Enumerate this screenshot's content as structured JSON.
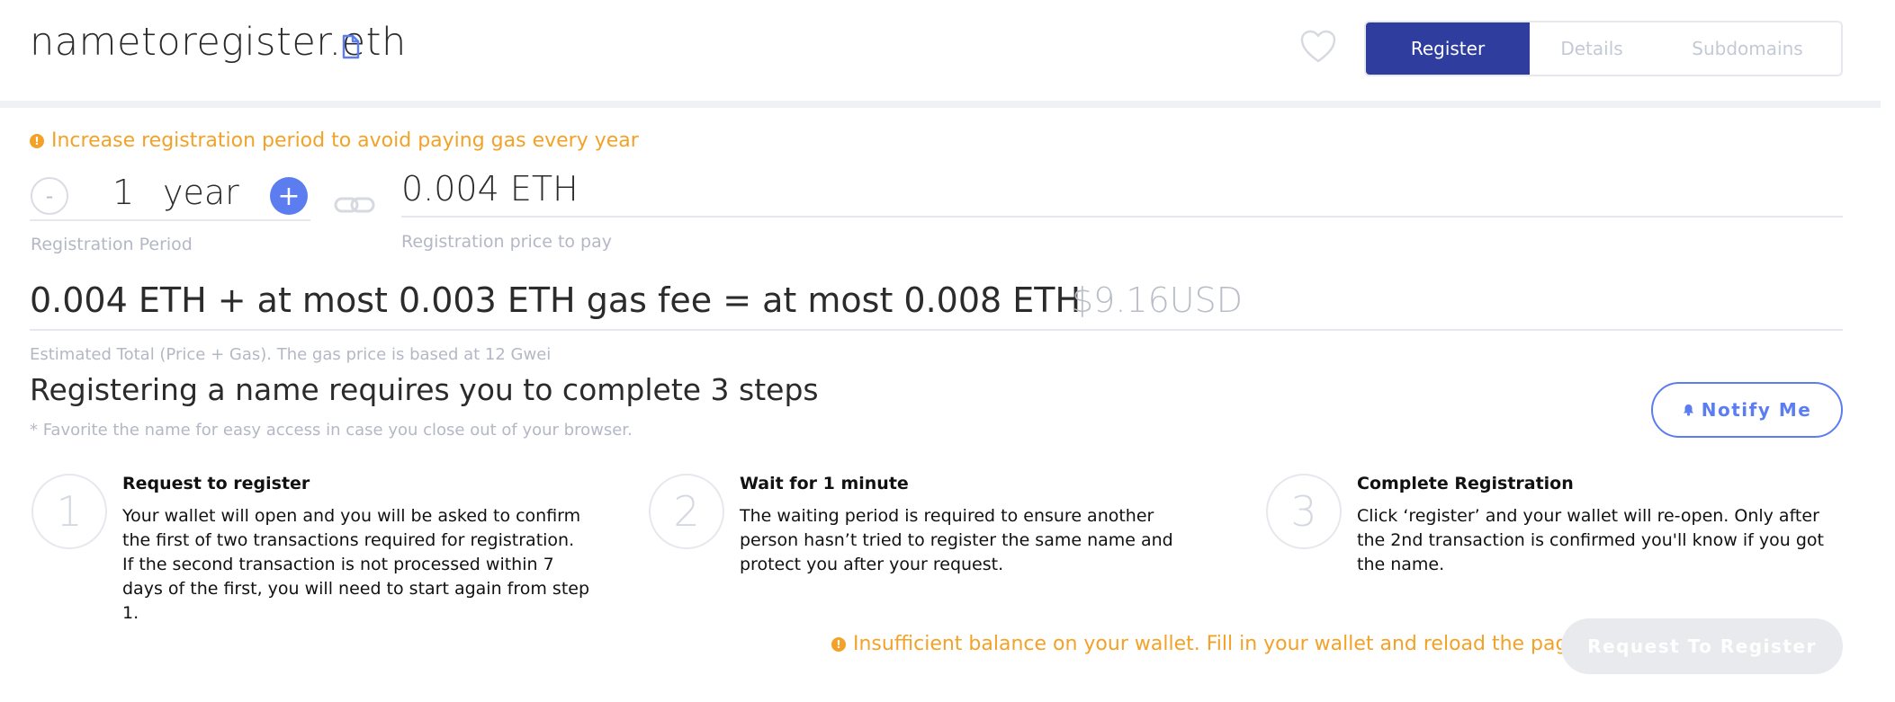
{
  "header": {
    "domain_name": "nametoregister.eth",
    "tabs": [
      {
        "label": "Register",
        "active": true
      },
      {
        "label": "Details",
        "active": false
      },
      {
        "label": "Subdomains",
        "active": false
      }
    ]
  },
  "period_warning": "Increase registration period to avoid paying gas every year",
  "registration": {
    "period_value": "1",
    "period_unit": "year",
    "minus_label": "-",
    "plus_label": "+",
    "period_label": "Registration Period",
    "price": "0.004 ETH",
    "price_label": "Registration price to pay"
  },
  "total": {
    "text": "0.004 ETH + at most 0.003 ETH gas fee = at most 0.008 ETH",
    "usd": "$9.16USD",
    "caption": "Estimated Total (Price + Gas). The gas price is based at 12 Gwei"
  },
  "steps_section": {
    "heading": "Registering a name requires you to complete 3 steps",
    "note": "* Favorite the name for easy access in case you close out of your browser.",
    "notify_label": "Notify Me",
    "steps": [
      {
        "number": "1",
        "title": "Request to register",
        "description": "Your wallet will open and you will be asked to confirm the first of two transactions required for registration. If the second transaction is not processed within 7 days of the first, you will need to start again from step 1."
      },
      {
        "number": "2",
        "title": "Wait for 1 minute",
        "description": "The waiting period is required to ensure another person hasn’t tried to register the same name and protect you after your request."
      },
      {
        "number": "3",
        "title": "Complete Registration",
        "description": "Click ‘register’ and your wallet will re-open. Only after the 2nd transaction is confirmed you'll know if you got the name."
      }
    ]
  },
  "footer": {
    "balance_warning": "Insufficient balance on your wallet. Fill in your wallet and reload the page.",
    "request_label": "Request To Register"
  },
  "colors": {
    "primary": "#2f3e9e",
    "accent": "#5c7df0",
    "warning": "#f3a227",
    "muted": "#b3b8c4"
  },
  "icons": [
    "copy-icon",
    "heart-icon",
    "warning-icon",
    "link-icon",
    "bell-icon"
  ]
}
